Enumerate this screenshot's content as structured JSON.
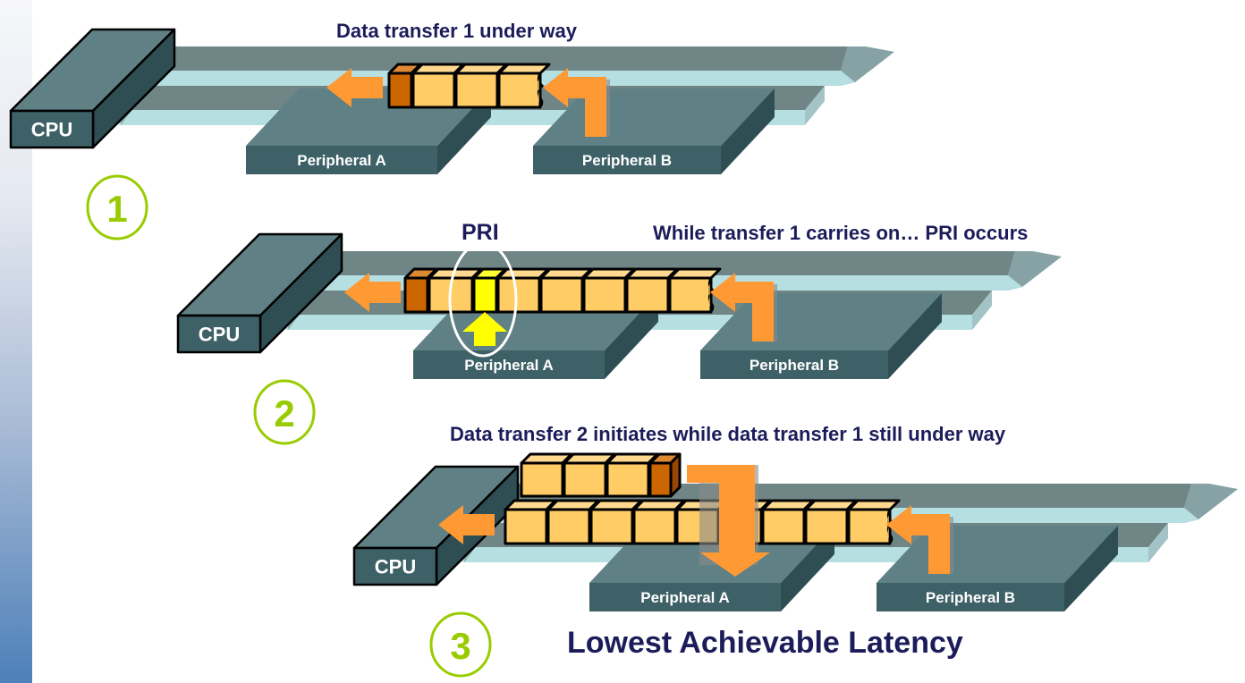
{
  "panels": [
    {
      "step": "1",
      "caption": "Data transfer 1 under way",
      "cpu_label": "CPU",
      "peripheral_a_label": "Peripheral A",
      "peripheral_b_label": "Peripheral B",
      "transfer1_blocks": 4,
      "transfer1_head_color": "#cc6600"
    },
    {
      "step": "2",
      "marker_label": "PRI",
      "caption": "While transfer 1 carries on… PRI occurs",
      "cpu_label": "CPU",
      "peripheral_a_label": "Peripheral A",
      "peripheral_b_label": "Peripheral B",
      "transfer1_blocks": 8,
      "highlight_color": "#ffff00"
    },
    {
      "step": "3",
      "caption": "Data transfer 2 initiates while data transfer 1 still under way",
      "cpu_label": "CPU",
      "peripheral_a_label": "Peripheral A",
      "peripheral_b_label": "Peripheral B",
      "transfer1_blocks": 9,
      "transfer2_blocks": 4
    }
  ],
  "footer_title": "Lowest Achievable Latency",
  "colors": {
    "box_front": "#3e6167",
    "box_top": "#5f8084",
    "box_side": "#2f4e53",
    "bus_top": "#6f8586",
    "bus_front": "#b6dfe2",
    "packet": "#ffcc66",
    "packet_top": "#ffd98f",
    "arrow": "#ff9933",
    "step_circle": "#99cc00",
    "caption_text": "#1c1c5a"
  }
}
